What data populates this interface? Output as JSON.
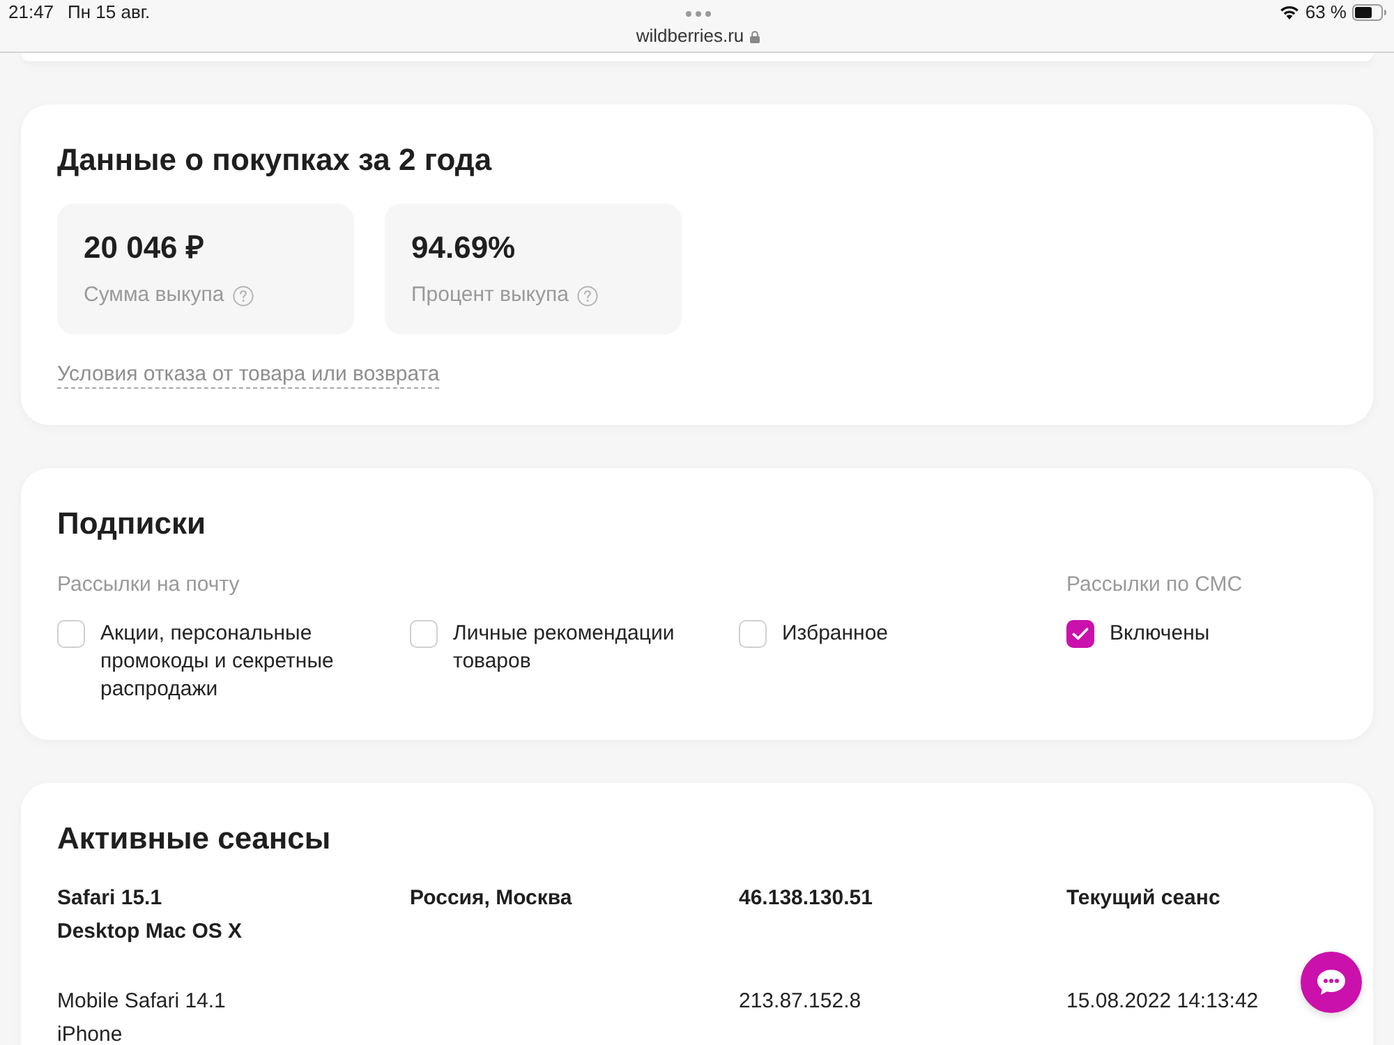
{
  "status_bar": {
    "time": "21:47",
    "date": "Пн 15 авг.",
    "url": "wildberries.ru",
    "battery": "63 %"
  },
  "purchase_data": {
    "title": "Данные о покупках за 2 года",
    "stats": [
      {
        "value": "20 046 ₽",
        "label": "Сумма выкупа"
      },
      {
        "value": "94.69%",
        "label": "Процент выкупа"
      }
    ],
    "link": "Условия отказа от товара или возврата"
  },
  "subscriptions": {
    "title": "Подписки",
    "groups": [
      {
        "label": "Рассылки на почту",
        "options": [
          {
            "label": "Акции, персональные промокоды и секретные распродажи",
            "checked": false
          },
          {
            "label": "Личные рекомендации товаров",
            "checked": false
          },
          {
            "label": "Избранное",
            "checked": false
          }
        ]
      },
      {
        "label": "Рассылки по СМС",
        "options": [
          {
            "label": "Включены",
            "checked": true
          }
        ]
      }
    ]
  },
  "sessions": {
    "title": "Активные сеансы",
    "rows": [
      {
        "browser": "Safari 15.1",
        "device": "Desktop Mac OS X",
        "location": "Россия, Москва",
        "ip": "46.138.130.51",
        "status": "Текущий сеанс",
        "current": true
      },
      {
        "browser": "Mobile Safari 14.1",
        "device": "iPhone",
        "ip": "213.87.152.8",
        "status": "15.08.2022 14:13:42",
        "current": false
      }
    ]
  }
}
